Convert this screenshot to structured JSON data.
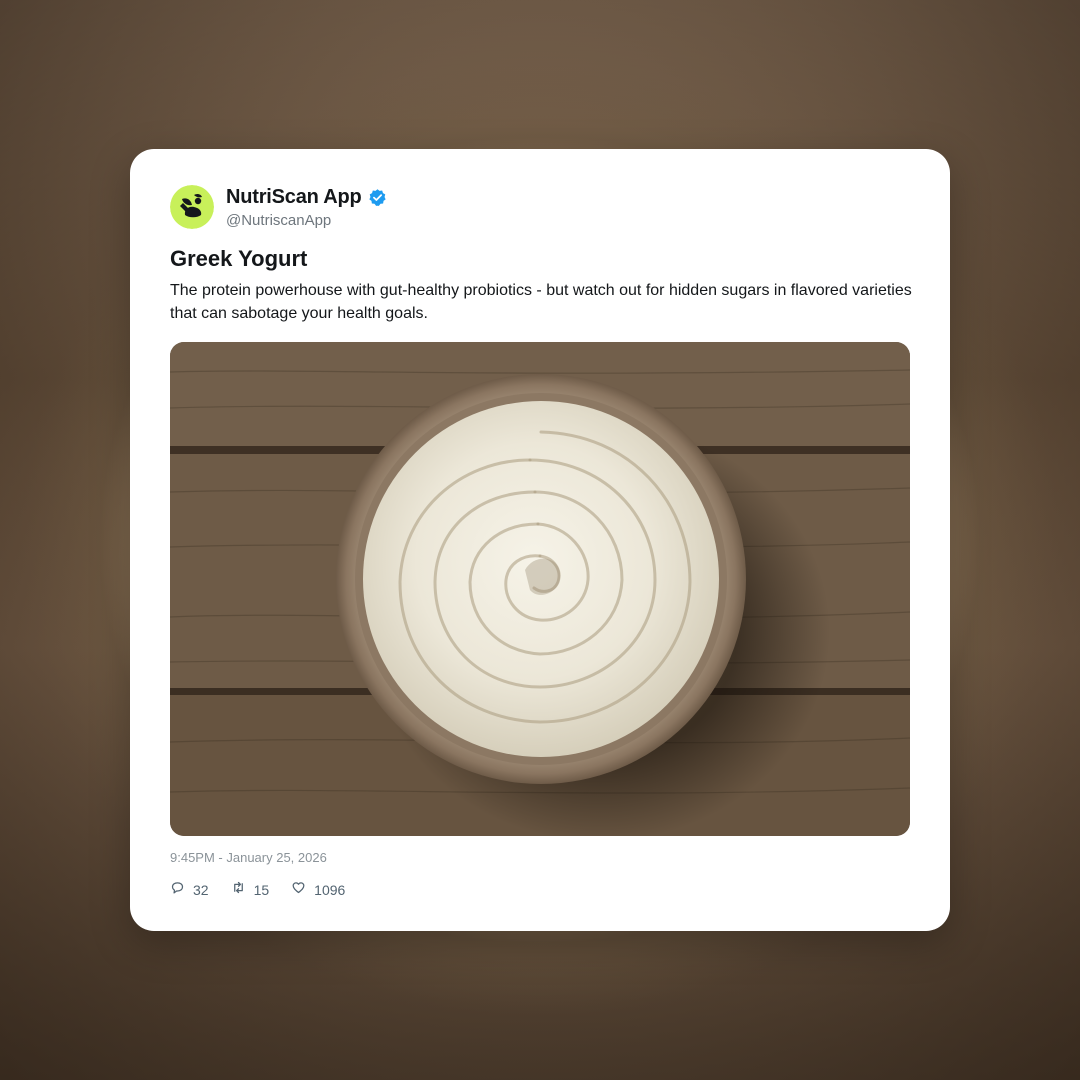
{
  "post": {
    "author": {
      "name": "NutriScan App",
      "handle": "@NutriscanApp",
      "avatar_icon": "nutriscan-logo-icon",
      "avatar_color": "#c8f05a",
      "verified_icon": "verified-badge-icon",
      "verified_color": "#1d9bf0"
    },
    "title": "Greek Yogurt",
    "text": "The protein powerhouse with gut-healthy probiotics - but watch out for hidden sugars in flavored varieties that can sabotage your health goals.",
    "image": {
      "description_icon": "greek-yogurt-bowl-photo"
    },
    "timestamp": "9:45PM - January 25, 2026",
    "stats": {
      "replies": "32",
      "reposts": "15",
      "likes": "1096"
    }
  }
}
